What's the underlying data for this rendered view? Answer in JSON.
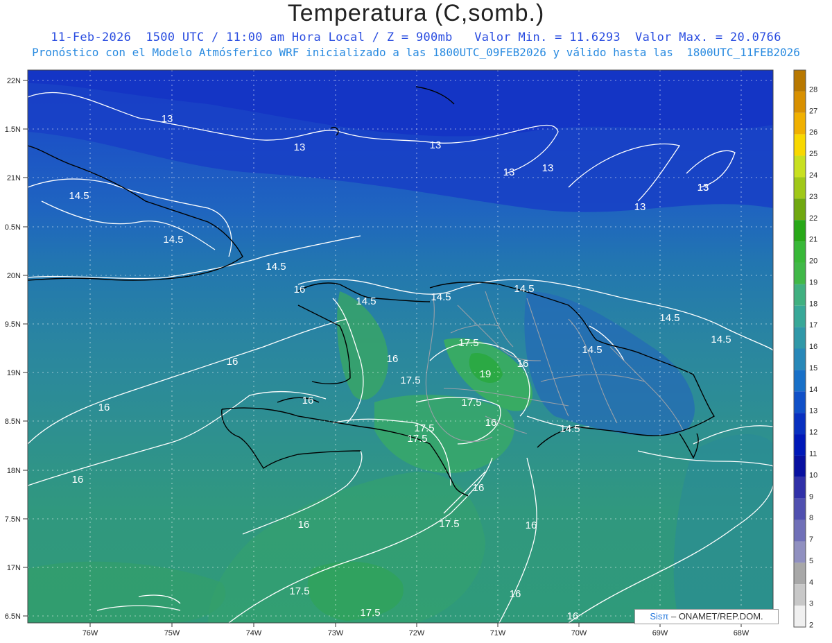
{
  "header": {
    "title": "Temperatura (C,somb.)",
    "line1": "11-Feb-2026  1500 UTC / 11:00 am Hora Local / Z = 900mb   Valor Min. = 11.6293  Valor Max. = 20.0766",
    "line2": "Pronóstico con el Modelo Atmósferico WRF inicializado a las 1800UTC_09FEB2026 y válido hasta las  1800UTC_11FEB2026"
  },
  "map": {
    "lat_labels": [
      "22N",
      "1.5N",
      "21N",
      "0.5N",
      "20N",
      "9.5N",
      "19N",
      "8.5N",
      "18N",
      "7.5N",
      "17N",
      "6.5N"
    ],
    "lon_labels": [
      "76W",
      "75W",
      "74W",
      "73W",
      "72W",
      "71W",
      "70W",
      "69W",
      "68W"
    ],
    "contour_labels": [
      "13",
      "13",
      "13",
      "13",
      "13",
      "13",
      "13",
      "13",
      "14.5",
      "14.5",
      "14.5",
      "14.5",
      "14.5",
      "14.5",
      "14.5",
      "14.5",
      "14.5",
      "14.5",
      "16",
      "16",
      "16",
      "16",
      "16",
      "16",
      "16",
      "16",
      "16",
      "16",
      "16",
      "16",
      "16",
      "17.5",
      "17.5",
      "17.5",
      "17.5",
      "17.5",
      "17.5",
      "17.5",
      "17.5",
      "19"
    ]
  },
  "colorbar": {
    "levels": [
      "28",
      "27",
      "26",
      "25",
      "24",
      "23",
      "22",
      "21",
      "20",
      "19",
      "18",
      "17",
      "16",
      "15",
      "14",
      "13",
      "12",
      "11",
      "10",
      "9",
      "8",
      "7",
      "5",
      "4",
      "3",
      "2"
    ],
    "colors": [
      "#b87800",
      "#d89000",
      "#f0b000",
      "#f8d800",
      "#c8e020",
      "#a0c818",
      "#70a810",
      "#28a818",
      "#38b838",
      "#40b848",
      "#40b080",
      "#38a898",
      "#3098a8",
      "#2888b8",
      "#1870c8",
      "#1050c8",
      "#0830c0",
      "#0018b8",
      "#0810a0",
      "#3030a8",
      "#5050b0",
      "#7070b8",
      "#9090c0",
      "#a8a8a8",
      "#c8c8c8",
      "#f0f0f0"
    ]
  },
  "credit": {
    "brand": "Sisπ",
    "text": " – ONAMET/REP.DOM."
  }
}
